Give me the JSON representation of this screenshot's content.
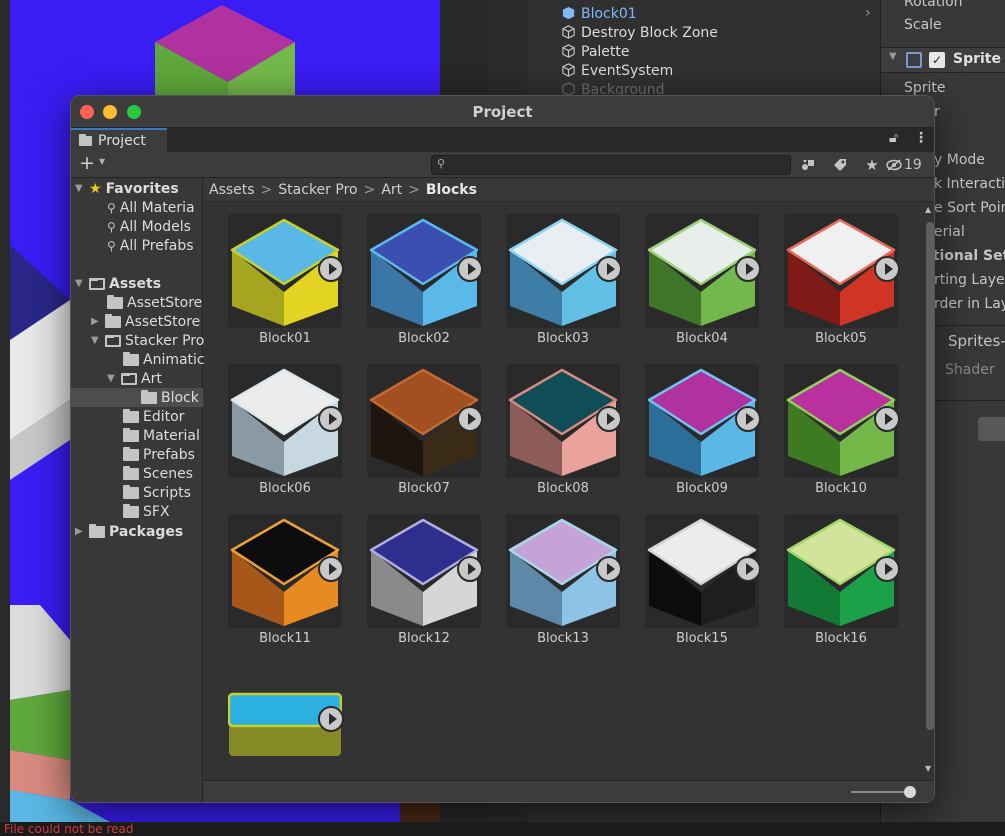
{
  "hierarchy": {
    "items": [
      {
        "label": "Block01",
        "selected": true
      },
      {
        "label": "Destroy Block Zone"
      },
      {
        "label": "Palette"
      },
      {
        "label": "EventSystem"
      },
      {
        "label": "Background"
      }
    ]
  },
  "inspector": {
    "rotation": "Rotation",
    "scale": "Scale",
    "component": "Sprite R",
    "rows": [
      "Sprite",
      "r",
      "y Mode",
      "k Interactio",
      "e Sort Poir",
      "erial",
      "itional Set",
      "rting Laye",
      "rder in Lay",
      "Sprites-",
      "Shader"
    ]
  },
  "window": {
    "title": "Project",
    "tab_label": "Project",
    "hidden_count": "19",
    "search_placeholder": ""
  },
  "sidebar": {
    "favorites_label": "Favorites",
    "favorites": [
      "All Materia",
      "All Models",
      "All Prefabs"
    ],
    "assets_label": "Assets",
    "assets_children": [
      "AssetStore",
      "AssetStore",
      "Stacker Pro"
    ],
    "stacker_children": [
      "Animatic",
      "Art"
    ],
    "art_children": [
      "Block"
    ],
    "stacker_more": [
      "Editor",
      "Material",
      "Prefabs",
      "Scenes",
      "Scripts",
      "SFX"
    ],
    "packages_label": "Packages"
  },
  "breadcrumb": [
    "Assets",
    "Stacker Pro",
    "Art",
    "Blocks"
  ],
  "breadcrumb_sep": ">",
  "assets": [
    {
      "name": "Block01",
      "top": "#5ab8e6",
      "left": "#a6a51f",
      "right": "#e3d322",
      "rim": "#c5d22c"
    },
    {
      "name": "Block02",
      "top": "#3b4fb0",
      "left": "#3a77a8",
      "right": "#5ab9e9",
      "rim": "#5bb9f0"
    },
    {
      "name": "Block03",
      "top": "#e9eef2",
      "left": "#3e7ea6",
      "right": "#62bfe6",
      "rim": "#8dd5f5"
    },
    {
      "name": "Block04",
      "top": "#e8eeea",
      "left": "#3f7528",
      "right": "#71b84d",
      "rim": "#9ed27b"
    },
    {
      "name": "Block05",
      "top": "#f0f0f0",
      "left": "#7e1b16",
      "right": "#d03424",
      "rim": "#e76a58"
    },
    {
      "name": "Block06",
      "top": "#ececec",
      "left": "#8a9aa3",
      "right": "#c7d8e1",
      "rim": "#dde7ec"
    },
    {
      "name": "Block07",
      "top": "#a24f22",
      "left": "#1e150e",
      "right": "#3a2a18",
      "rim": "#c26a30"
    },
    {
      "name": "Block08",
      "top": "#0f4d57",
      "left": "#8d5c58",
      "right": "#e9a39a",
      "rim": "#d78c80"
    },
    {
      "name": "Block09",
      "top": "#b0329f",
      "left": "#2d6d99",
      "right": "#5ab7e6",
      "rim": "#70c3f0"
    },
    {
      "name": "Block10",
      "top": "#b8319f",
      "left": "#3d7a22",
      "right": "#74b84a",
      "rim": "#94d05c"
    },
    {
      "name": "Block11",
      "top": "#0c0c0c",
      "left": "#a8571a",
      "right": "#e88a22",
      "rim": "#f0a038"
    },
    {
      "name": "Block12",
      "top": "#2f2d8d",
      "left": "#8a8a8a",
      "right": "#d6d6d6",
      "rim": "#b0b0e0"
    },
    {
      "name": "Block13",
      "top": "#c6a3d6",
      "left": "#5d88a8",
      "right": "#8cc3e6",
      "rim": "#a8d8ec"
    },
    {
      "name": "Block15",
      "top": "#ececec",
      "left": "#0c0c0c",
      "right": "#1e1e1e",
      "rim": "#d4d4d4"
    },
    {
      "name": "Block16",
      "top": "#d3e39a",
      "left": "#137a35",
      "right": "#1ba148",
      "rim": "#a2d86a"
    }
  ],
  "partial_asset": {
    "top": "#2bb0e0",
    "side": "#848a25",
    "rim": "#c5d22c"
  },
  "status": "File could not be read"
}
